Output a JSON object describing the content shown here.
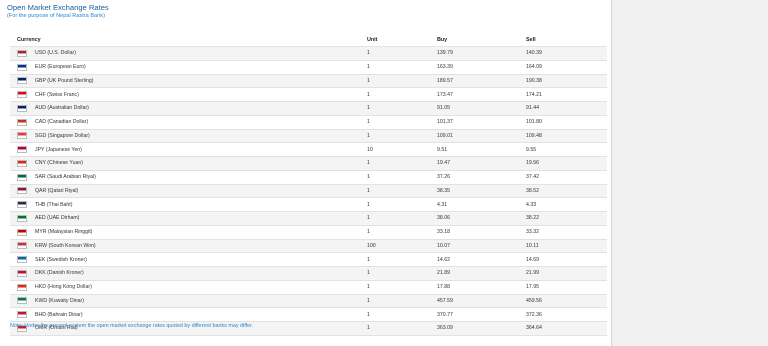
{
  "header": {
    "title": "Open Market Exchange Rates",
    "subtitle": "(For the purpose of Nepal Rastra Bank)"
  },
  "table": {
    "columns": [
      "Currency",
      "Unit",
      "Buy",
      "Sell"
    ],
    "rows": [
      {
        "currency": "USD (U.S. Dollar)",
        "unit": "1",
        "buy": "139.79",
        "sell": "140.39",
        "flag_icon": "us-flag-icon",
        "flag_color": "#b22234"
      },
      {
        "currency": "EUR (European Euro)",
        "unit": "1",
        "buy": "163.39",
        "sell": "164.09",
        "flag_icon": "eu-flag-icon",
        "flag_color": "#003399"
      },
      {
        "currency": "GBP (UK Pound Sterling)",
        "unit": "1",
        "buy": "189.57",
        "sell": "190.38",
        "flag_icon": "uk-flag-icon",
        "flag_color": "#012169"
      },
      {
        "currency": "CHF (Swiss Franc)",
        "unit": "1",
        "buy": "173.47",
        "sell": "174.21",
        "flag_icon": "swiss-flag-icon",
        "flag_color": "#e30613"
      },
      {
        "currency": "AUD (Australian Dollar)",
        "unit": "1",
        "buy": "91.05",
        "sell": "91.44",
        "flag_icon": "australia-flag-icon",
        "flag_color": "#012169"
      },
      {
        "currency": "CAD (Canadian Dollar)",
        "unit": "1",
        "buy": "101.37",
        "sell": "101.80",
        "flag_icon": "canada-flag-icon",
        "flag_color": "#d52b1e"
      },
      {
        "currency": "SGD (Singapore Dollar)",
        "unit": "1",
        "buy": "109.01",
        "sell": "109.48",
        "flag_icon": "singapore-flag-icon",
        "flag_color": "#ef3340"
      },
      {
        "currency": "JPY (Japanese Yen)",
        "unit": "10",
        "buy": "9.51",
        "sell": "9.55",
        "flag_icon": "japan-flag-icon",
        "flag_color": "#bc002d"
      },
      {
        "currency": "CNY (Chinese Yuan)",
        "unit": "1",
        "buy": "19.47",
        "sell": "19.56",
        "flag_icon": "china-flag-icon",
        "flag_color": "#de2910"
      },
      {
        "currency": "SAR (Saudi Arabian Riyal)",
        "unit": "1",
        "buy": "37.26",
        "sell": "37.42",
        "flag_icon": "saudi-flag-icon",
        "flag_color": "#006c35"
      },
      {
        "currency": "QAR (Qatari Riyal)",
        "unit": "1",
        "buy": "38.35",
        "sell": "38.52",
        "flag_icon": "qatar-flag-icon",
        "flag_color": "#8a1538"
      },
      {
        "currency": "THB (Thai Baht)",
        "unit": "1",
        "buy": "4.31",
        "sell": "4.33",
        "flag_icon": "thailand-flag-icon",
        "flag_color": "#2d2a4a"
      },
      {
        "currency": "AED (UAE Dirham)",
        "unit": "1",
        "buy": "38.06",
        "sell": "38.22",
        "flag_icon": "uae-flag-icon",
        "flag_color": "#00732f"
      },
      {
        "currency": "MYR (Malaysian Ringgit)",
        "unit": "1",
        "buy": "33.18",
        "sell": "33.32",
        "flag_icon": "malaysia-flag-icon",
        "flag_color": "#cc0001"
      },
      {
        "currency": "KRW (South Korean Won)",
        "unit": "100",
        "buy": "10.07",
        "sell": "10.11",
        "flag_icon": "korea-flag-icon",
        "flag_color": "#cd2e3a"
      },
      {
        "currency": "SEK (Swedish Kroner)",
        "unit": "1",
        "buy": "14.62",
        "sell": "14.69",
        "flag_icon": "sweden-flag-icon",
        "flag_color": "#006aa7"
      },
      {
        "currency": "DKK (Danish Kroner)",
        "unit": "1",
        "buy": "21.89",
        "sell": "21.99",
        "flag_icon": "denmark-flag-icon",
        "flag_color": "#c60c30"
      },
      {
        "currency": "HKD (Hong Kong Dollar)",
        "unit": "1",
        "buy": "17.88",
        "sell": "17.95",
        "flag_icon": "hongkong-flag-icon",
        "flag_color": "#de2910"
      },
      {
        "currency": "KWD (Kuwaity Dinar)",
        "unit": "1",
        "buy": "457.59",
        "sell": "459.56",
        "flag_icon": "kuwait-flag-icon",
        "flag_color": "#007a3d"
      },
      {
        "currency": "BHD (Bahrain Dinar)",
        "unit": "1",
        "buy": "370.77",
        "sell": "372.36",
        "flag_icon": "bahrain-flag-icon",
        "flag_color": "#ce1126"
      },
      {
        "currency": "OMR (Omani Rial)",
        "unit": "1",
        "buy": "363.09",
        "sell": "364.64",
        "flag_icon": "oman-flag-icon",
        "flag_color": "#db161b"
      }
    ]
  },
  "note": "Note: Under the present system the open market exchange rates quoted by different banks may differ."
}
